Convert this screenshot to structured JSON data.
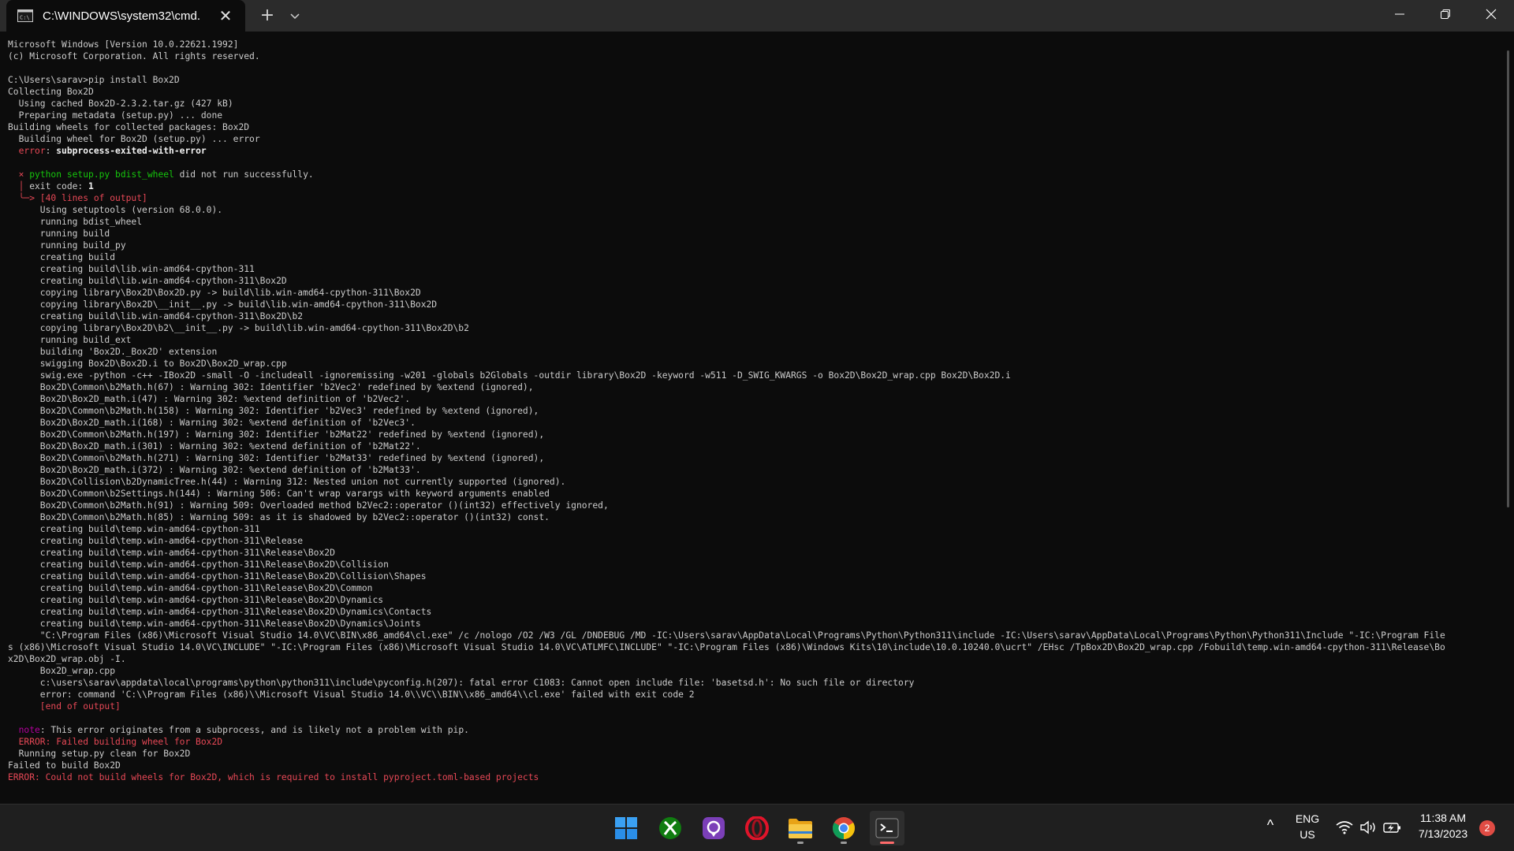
{
  "window": {
    "tab_title": "C:\\WINDOWS\\system32\\cmd.",
    "tab_close": "✕",
    "new_tab": "+"
  },
  "terminal": {
    "lines": [
      [
        {
          "t": "Microsoft Windows [Version 10.0.22621.1992]"
        }
      ],
      [
        {
          "t": "(c) Microsoft Corporation. All rights reserved."
        }
      ],
      [
        {
          "t": ""
        }
      ],
      [
        {
          "t": "C:\\Users\\sarav>pip install Box2D"
        }
      ],
      [
        {
          "t": "Collecting Box2D"
        }
      ],
      [
        {
          "t": "  Using cached Box2D-2.3.2.tar.gz (427 kB)"
        }
      ],
      [
        {
          "t": "  Preparing metadata (setup.py) ... done"
        }
      ],
      [
        {
          "t": "Building wheels for collected packages: Box2D"
        }
      ],
      [
        {
          "t": "  Building wheel for Box2D (setup.py) ... error"
        }
      ],
      [
        {
          "t": "  "
        },
        {
          "t": "error",
          "c": "red"
        },
        {
          "t": ": "
        },
        {
          "t": "subprocess-exited-with-error",
          "c": "bold"
        }
      ],
      [
        {
          "t": ""
        }
      ],
      [
        {
          "t": "  × ",
          "c": "red"
        },
        {
          "t": "python setup.py bdist_wheel",
          "c": "green"
        },
        {
          "t": " did not run successfully."
        }
      ],
      [
        {
          "t": "  │",
          "c": "red"
        },
        {
          "t": " exit code: "
        },
        {
          "t": "1",
          "c": "bold"
        }
      ],
      [
        {
          "t": "  ╰─> [40 lines of output]",
          "c": "red"
        }
      ],
      [
        {
          "t": "      Using setuptools (version 68.0.0)."
        }
      ],
      [
        {
          "t": "      running bdist_wheel"
        }
      ],
      [
        {
          "t": "      running build"
        }
      ],
      [
        {
          "t": "      running build_py"
        }
      ],
      [
        {
          "t": "      creating build"
        }
      ],
      [
        {
          "t": "      creating build\\lib.win-amd64-cpython-311"
        }
      ],
      [
        {
          "t": "      creating build\\lib.win-amd64-cpython-311\\Box2D"
        }
      ],
      [
        {
          "t": "      copying library\\Box2D\\Box2D.py -> build\\lib.win-amd64-cpython-311\\Box2D"
        }
      ],
      [
        {
          "t": "      copying library\\Box2D\\__init__.py -> build\\lib.win-amd64-cpython-311\\Box2D"
        }
      ],
      [
        {
          "t": "      creating build\\lib.win-amd64-cpython-311\\Box2D\\b2"
        }
      ],
      [
        {
          "t": "      copying library\\Box2D\\b2\\__init__.py -> build\\lib.win-amd64-cpython-311\\Box2D\\b2"
        }
      ],
      [
        {
          "t": "      running build_ext"
        }
      ],
      [
        {
          "t": "      building 'Box2D._Box2D' extension"
        }
      ],
      [
        {
          "t": "      swigging Box2D\\Box2D.i to Box2D\\Box2D_wrap.cpp"
        }
      ],
      [
        {
          "t": "      swig.exe -python -c++ -IBox2D -small -O -includeall -ignoremissing -w201 -globals b2Globals -outdir library\\Box2D -keyword -w511 -D_SWIG_KWARGS -o Box2D\\Box2D_wrap.cpp Box2D\\Box2D.i"
        }
      ],
      [
        {
          "t": "      Box2D\\Common\\b2Math.h(67) : Warning 302: Identifier 'b2Vec2' redefined by %extend (ignored),"
        }
      ],
      [
        {
          "t": "      Box2D\\Box2D_math.i(47) : Warning 302: %extend definition of 'b2Vec2'."
        }
      ],
      [
        {
          "t": "      Box2D\\Common\\b2Math.h(158) : Warning 302: Identifier 'b2Vec3' redefined by %extend (ignored),"
        }
      ],
      [
        {
          "t": "      Box2D\\Box2D_math.i(168) : Warning 302: %extend definition of 'b2Vec3'."
        }
      ],
      [
        {
          "t": "      Box2D\\Common\\b2Math.h(197) : Warning 302: Identifier 'b2Mat22' redefined by %extend (ignored),"
        }
      ],
      [
        {
          "t": "      Box2D\\Box2D_math.i(301) : Warning 302: %extend definition of 'b2Mat22'."
        }
      ],
      [
        {
          "t": "      Box2D\\Common\\b2Math.h(271) : Warning 302: Identifier 'b2Mat33' redefined by %extend (ignored),"
        }
      ],
      [
        {
          "t": "      Box2D\\Box2D_math.i(372) : Warning 302: %extend definition of 'b2Mat33'."
        }
      ],
      [
        {
          "t": "      Box2D\\Collision\\b2DynamicTree.h(44) : Warning 312: Nested union not currently supported (ignored)."
        }
      ],
      [
        {
          "t": "      Box2D\\Common\\b2Settings.h(144) : Warning 506: Can't wrap varargs with keyword arguments enabled"
        }
      ],
      [
        {
          "t": "      Box2D\\Common\\b2Math.h(91) : Warning 509: Overloaded method b2Vec2::operator ()(int32) effectively ignored,"
        }
      ],
      [
        {
          "t": "      Box2D\\Common\\b2Math.h(85) : Warning 509: as it is shadowed by b2Vec2::operator ()(int32) const."
        }
      ],
      [
        {
          "t": "      creating build\\temp.win-amd64-cpython-311"
        }
      ],
      [
        {
          "t": "      creating build\\temp.win-amd64-cpython-311\\Release"
        }
      ],
      [
        {
          "t": "      creating build\\temp.win-amd64-cpython-311\\Release\\Box2D"
        }
      ],
      [
        {
          "t": "      creating build\\temp.win-amd64-cpython-311\\Release\\Box2D\\Collision"
        }
      ],
      [
        {
          "t": "      creating build\\temp.win-amd64-cpython-311\\Release\\Box2D\\Collision\\Shapes"
        }
      ],
      [
        {
          "t": "      creating build\\temp.win-amd64-cpython-311\\Release\\Box2D\\Common"
        }
      ],
      [
        {
          "t": "      creating build\\temp.win-amd64-cpython-311\\Release\\Box2D\\Dynamics"
        }
      ],
      [
        {
          "t": "      creating build\\temp.win-amd64-cpython-311\\Release\\Box2D\\Dynamics\\Contacts"
        }
      ],
      [
        {
          "t": "      creating build\\temp.win-amd64-cpython-311\\Release\\Box2D\\Dynamics\\Joints"
        }
      ],
      [
        {
          "t": "      \"C:\\Program Files (x86)\\Microsoft Visual Studio 14.0\\VC\\BIN\\x86_amd64\\cl.exe\" /c /nologo /O2 /W3 /GL /DNDEBUG /MD -IC:\\Users\\sarav\\AppData\\Local\\Programs\\Python\\Python311\\include -IC:\\Users\\sarav\\AppData\\Local\\Programs\\Python\\Python311\\Include \"-IC:\\Program File"
        }
      ],
      [
        {
          "t": "s (x86)\\Microsoft Visual Studio 14.0\\VC\\INCLUDE\" \"-IC:\\Program Files (x86)\\Microsoft Visual Studio 14.0\\VC\\ATLMFC\\INCLUDE\" \"-IC:\\Program Files (x86)\\Windows Kits\\10\\include\\10.0.10240.0\\ucrt\" /EHsc /TpBox2D\\Box2D_wrap.cpp /Fobuild\\temp.win-amd64-cpython-311\\Release\\Bo"
        }
      ],
      [
        {
          "t": "x2D\\Box2D_wrap.obj -I."
        }
      ],
      [
        {
          "t": "      Box2D_wrap.cpp"
        }
      ],
      [
        {
          "t": "      c:\\users\\sarav\\appdata\\local\\programs\\python\\python311\\include\\pyconfig.h(207): fatal error C1083: Cannot open include file: 'basetsd.h': No such file or directory"
        }
      ],
      [
        {
          "t": "      error: command 'C:\\\\Program Files (x86)\\\\Microsoft Visual Studio 14.0\\\\VC\\\\BIN\\\\x86_amd64\\\\cl.exe' failed with exit code 2"
        }
      ],
      [
        {
          "t": "      [end of output]",
          "c": "red"
        }
      ],
      [
        {
          "t": ""
        }
      ],
      [
        {
          "t": "  "
        },
        {
          "t": "note",
          "c": "mag"
        },
        {
          "t": ": This error originates from a subprocess, and is likely not a problem with pip."
        }
      ],
      [
        {
          "t": "  ERROR: Failed building wheel for Box2D",
          "c": "red"
        }
      ],
      [
        {
          "t": "  Running setup.py clean for Box2D"
        }
      ],
      [
        {
          "t": "Failed to build Box2D"
        }
      ],
      [
        {
          "t": "ERROR: Could not build wheels for Box2D, which is required to install pyproject.toml-based projects",
          "c": "red"
        }
      ]
    ]
  },
  "taskbar": {
    "apps": [
      {
        "name": "start-icon"
      },
      {
        "name": "xbox-icon"
      },
      {
        "name": "app-icon"
      },
      {
        "name": "opera-icon"
      },
      {
        "name": "file-explorer-icon"
      },
      {
        "name": "chrome-icon"
      },
      {
        "name": "terminal-icon"
      }
    ],
    "tray": {
      "chevron": "^",
      "lang_top": "ENG",
      "lang_bottom": "US",
      "time": "11:38 AM",
      "date": "7/13/2023",
      "notification_count": "2"
    }
  },
  "colors": {
    "red": "#e74856",
    "green": "#16c60c",
    "magenta": "#b4009e",
    "terminal_bg": "#0c0c0c",
    "terminal_fg": "#cccccc"
  }
}
